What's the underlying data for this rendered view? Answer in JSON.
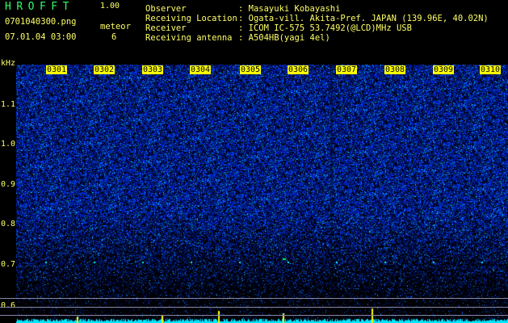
{
  "header": {
    "app_title": "HROFFT",
    "version": "1.00",
    "filename": "0701040300.png",
    "datetime": "07.01.04 03:00",
    "meteor_label": "meteor",
    "meteor_count": "6"
  },
  "info": [
    {
      "label": "Observer",
      "value": ": Masayuki Kobayashi"
    },
    {
      "label": "Receiving Location",
      "value": ": Ogata-vill. Akita-Pref. JAPAN (139.96E, 40.02N)"
    },
    {
      "label": "Receiver",
      "value": ": ICOM IC-575 53.7492(@LCD)MHz USB"
    },
    {
      "label": "Receiving antenna",
      "value": ": A504HB(yagi 4el)"
    }
  ],
  "axis": {
    "unit": "kHz",
    "y_ticks": [
      "1.1",
      "1.0",
      "0.9",
      "0.8",
      "0.7",
      "0.6"
    ],
    "x_ticks": [
      "0301",
      "0302",
      "0303",
      "0304",
      "0305",
      "0306",
      "0307",
      "0308",
      "0309",
      "0310"
    ]
  },
  "colors": {
    "text": "#ffff66",
    "title": "#33ff66",
    "noise": "#1e3cff",
    "spectrum": "#00e5ff"
  }
}
